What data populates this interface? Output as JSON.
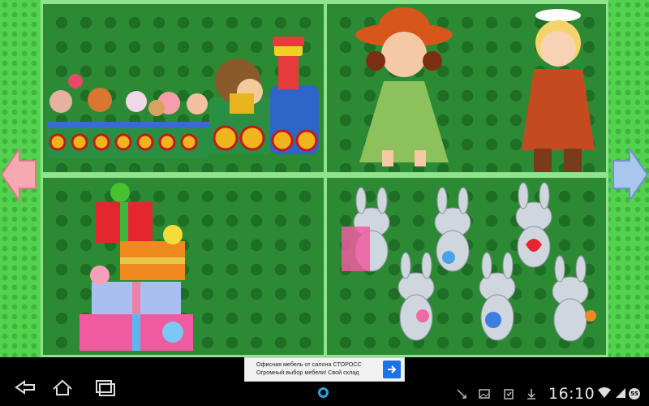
{
  "colors": {
    "background_green": "#53d14f",
    "panel_green": "#2d8a34",
    "frame_light_green": "#8fe38a",
    "arrow_pink": "#f6a9b1",
    "arrow_blue": "#a9c6ec",
    "accent_blue": "#2aa3e0"
  },
  "gallery": {
    "tiles": [
      {
        "name": "train-with-animals",
        "icon": "toy-train"
      },
      {
        "name": "dolls",
        "icon": "two-dolls"
      },
      {
        "name": "gift-boxes",
        "icon": "gift-stack"
      },
      {
        "name": "bunnies",
        "icon": "bunny-group"
      }
    ]
  },
  "ad": {
    "line1": "Офисная мебель от салона СТОРОСС",
    "line2": "Огромный выбор мебели! Свой склад",
    "go_icon": "arrow-right-icon"
  },
  "system": {
    "time": "16:10",
    "battery": "55"
  }
}
